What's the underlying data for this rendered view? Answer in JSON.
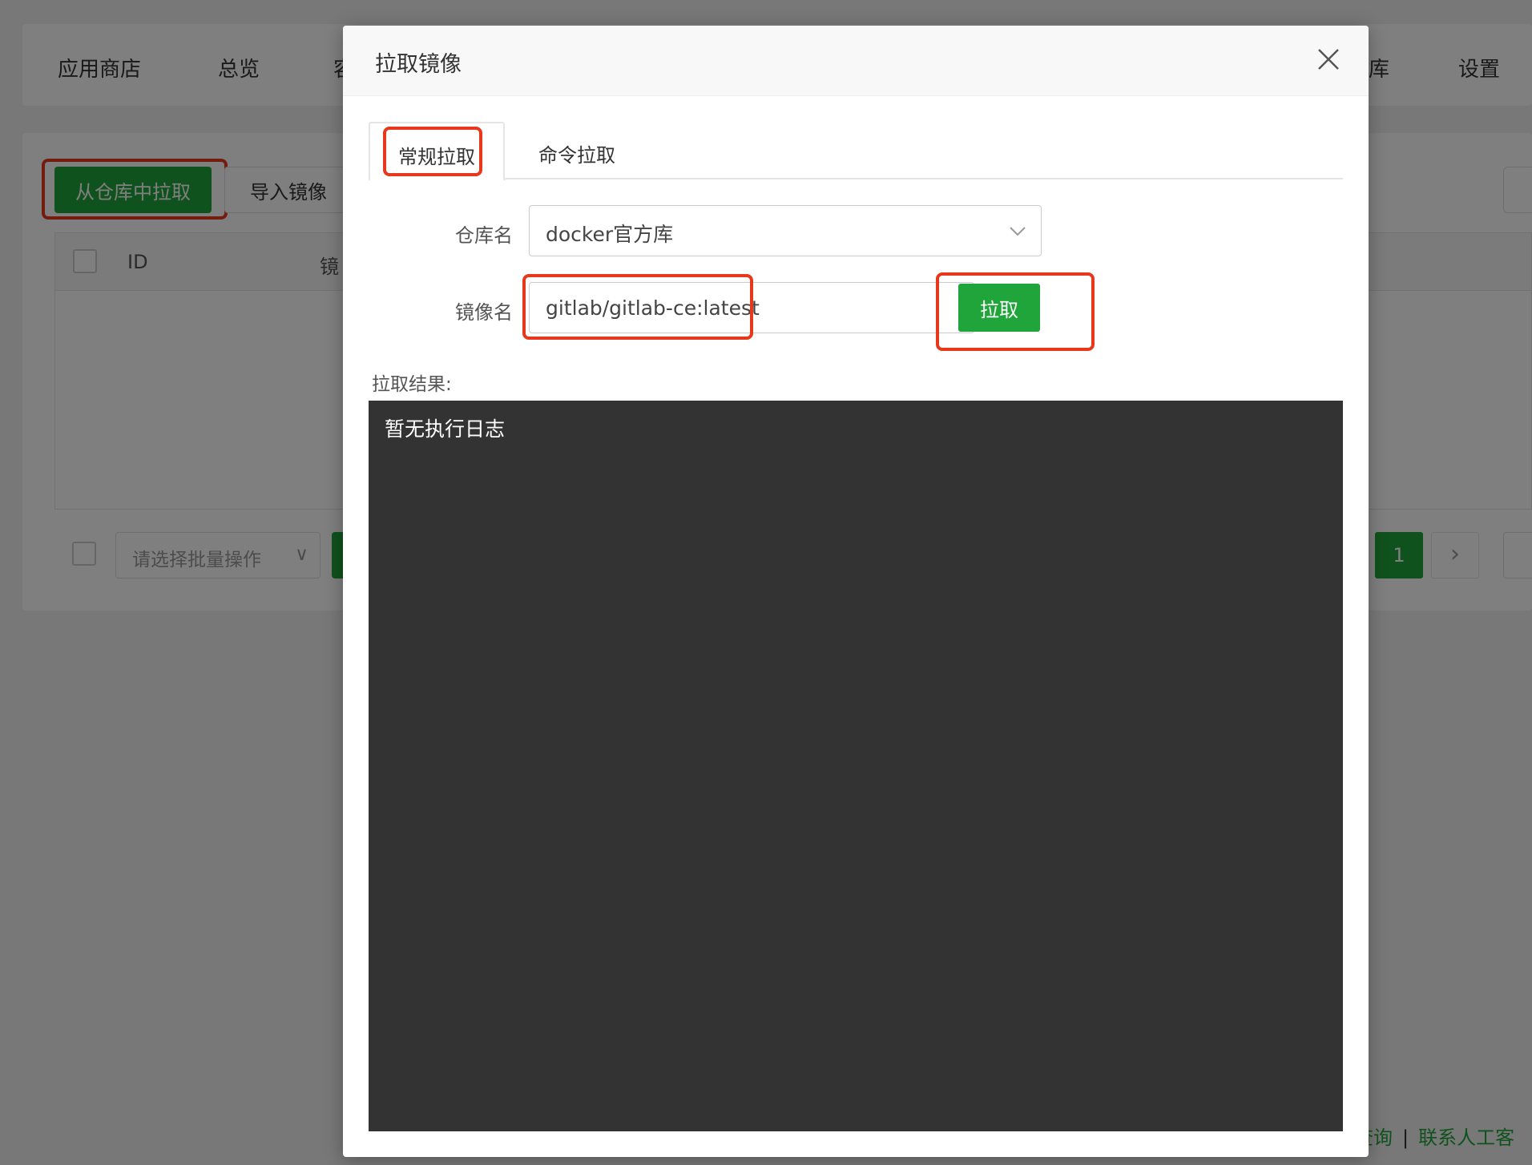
{
  "nav": {
    "items": [
      "应用商店",
      "总览",
      "容",
      "库",
      "设置"
    ]
  },
  "toolbar": {
    "pull_from_repo": "从仓库中拉取",
    "import_image": "导入镜像"
  },
  "table": {
    "columns": [
      "ID",
      "镜"
    ]
  },
  "footer": {
    "batch_placeholder": "请选择批量操作",
    "current_page": "1",
    "next_icon": "›"
  },
  "bottom_links": {
    "left": "查询",
    "separator": "|",
    "right": "联系人工客"
  },
  "modal": {
    "title": "拉取镜像",
    "tabs": [
      {
        "label": "常规拉取",
        "active": true
      },
      {
        "label": "命令拉取",
        "active": false
      }
    ],
    "repo_label": "仓库名",
    "repo_value": "docker官方库",
    "image_label": "镜像名",
    "image_value": "gitlab/gitlab-ce:latest",
    "pull_button": "拉取",
    "result_label": "拉取结果:",
    "result_text": "暂无执行日志"
  },
  "colors": {
    "accent_green": "#20a53a",
    "highlight_red": "#e8381c",
    "terminal_bg": "#333333"
  }
}
